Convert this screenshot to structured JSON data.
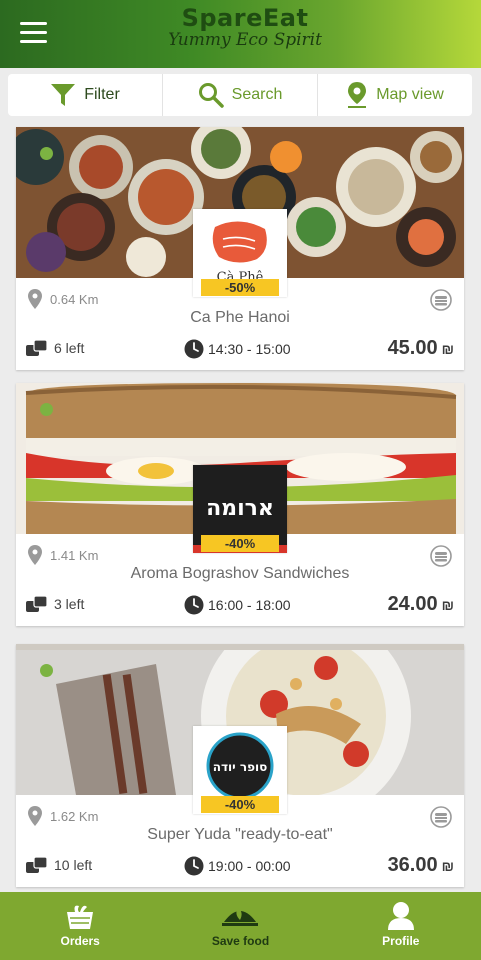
{
  "header": {
    "brand_title": "SpareEat",
    "brand_subtitle": "Yummy Eco Spirit"
  },
  "toolbar": {
    "filter_label": "Filter",
    "search_label": "Search",
    "map_label": "Map view"
  },
  "colors": {
    "brand_green": "#7fa830",
    "accent_yellow": "#f7c623"
  },
  "cards": [
    {
      "name": "Ca Phe Hanoi",
      "logo_text": "Cà Phê",
      "discount": "-50%",
      "distance": "0.64 Km",
      "left": "6 left",
      "time": "14:30 - 15:00",
      "price": "45.00",
      "currency": "₪"
    },
    {
      "name": "Aroma Bograshov Sandwiches",
      "logo_text": "ארומה",
      "discount": "-40%",
      "distance": "1.41 Km",
      "left": "3 left",
      "time": "16:00 - 18:00",
      "price": "24.00",
      "currency": "₪"
    },
    {
      "name": "Super Yuda \"ready-to-eat\"",
      "logo_text": "סופר יודה",
      "discount": "-40%",
      "distance": "1.62 Km",
      "left": "10 left",
      "time": "19:00 - 00:00",
      "price": "36.00",
      "currency": "₪"
    }
  ],
  "nav": {
    "orders": "Orders",
    "save_food": "Save food",
    "profile": "Profile"
  }
}
